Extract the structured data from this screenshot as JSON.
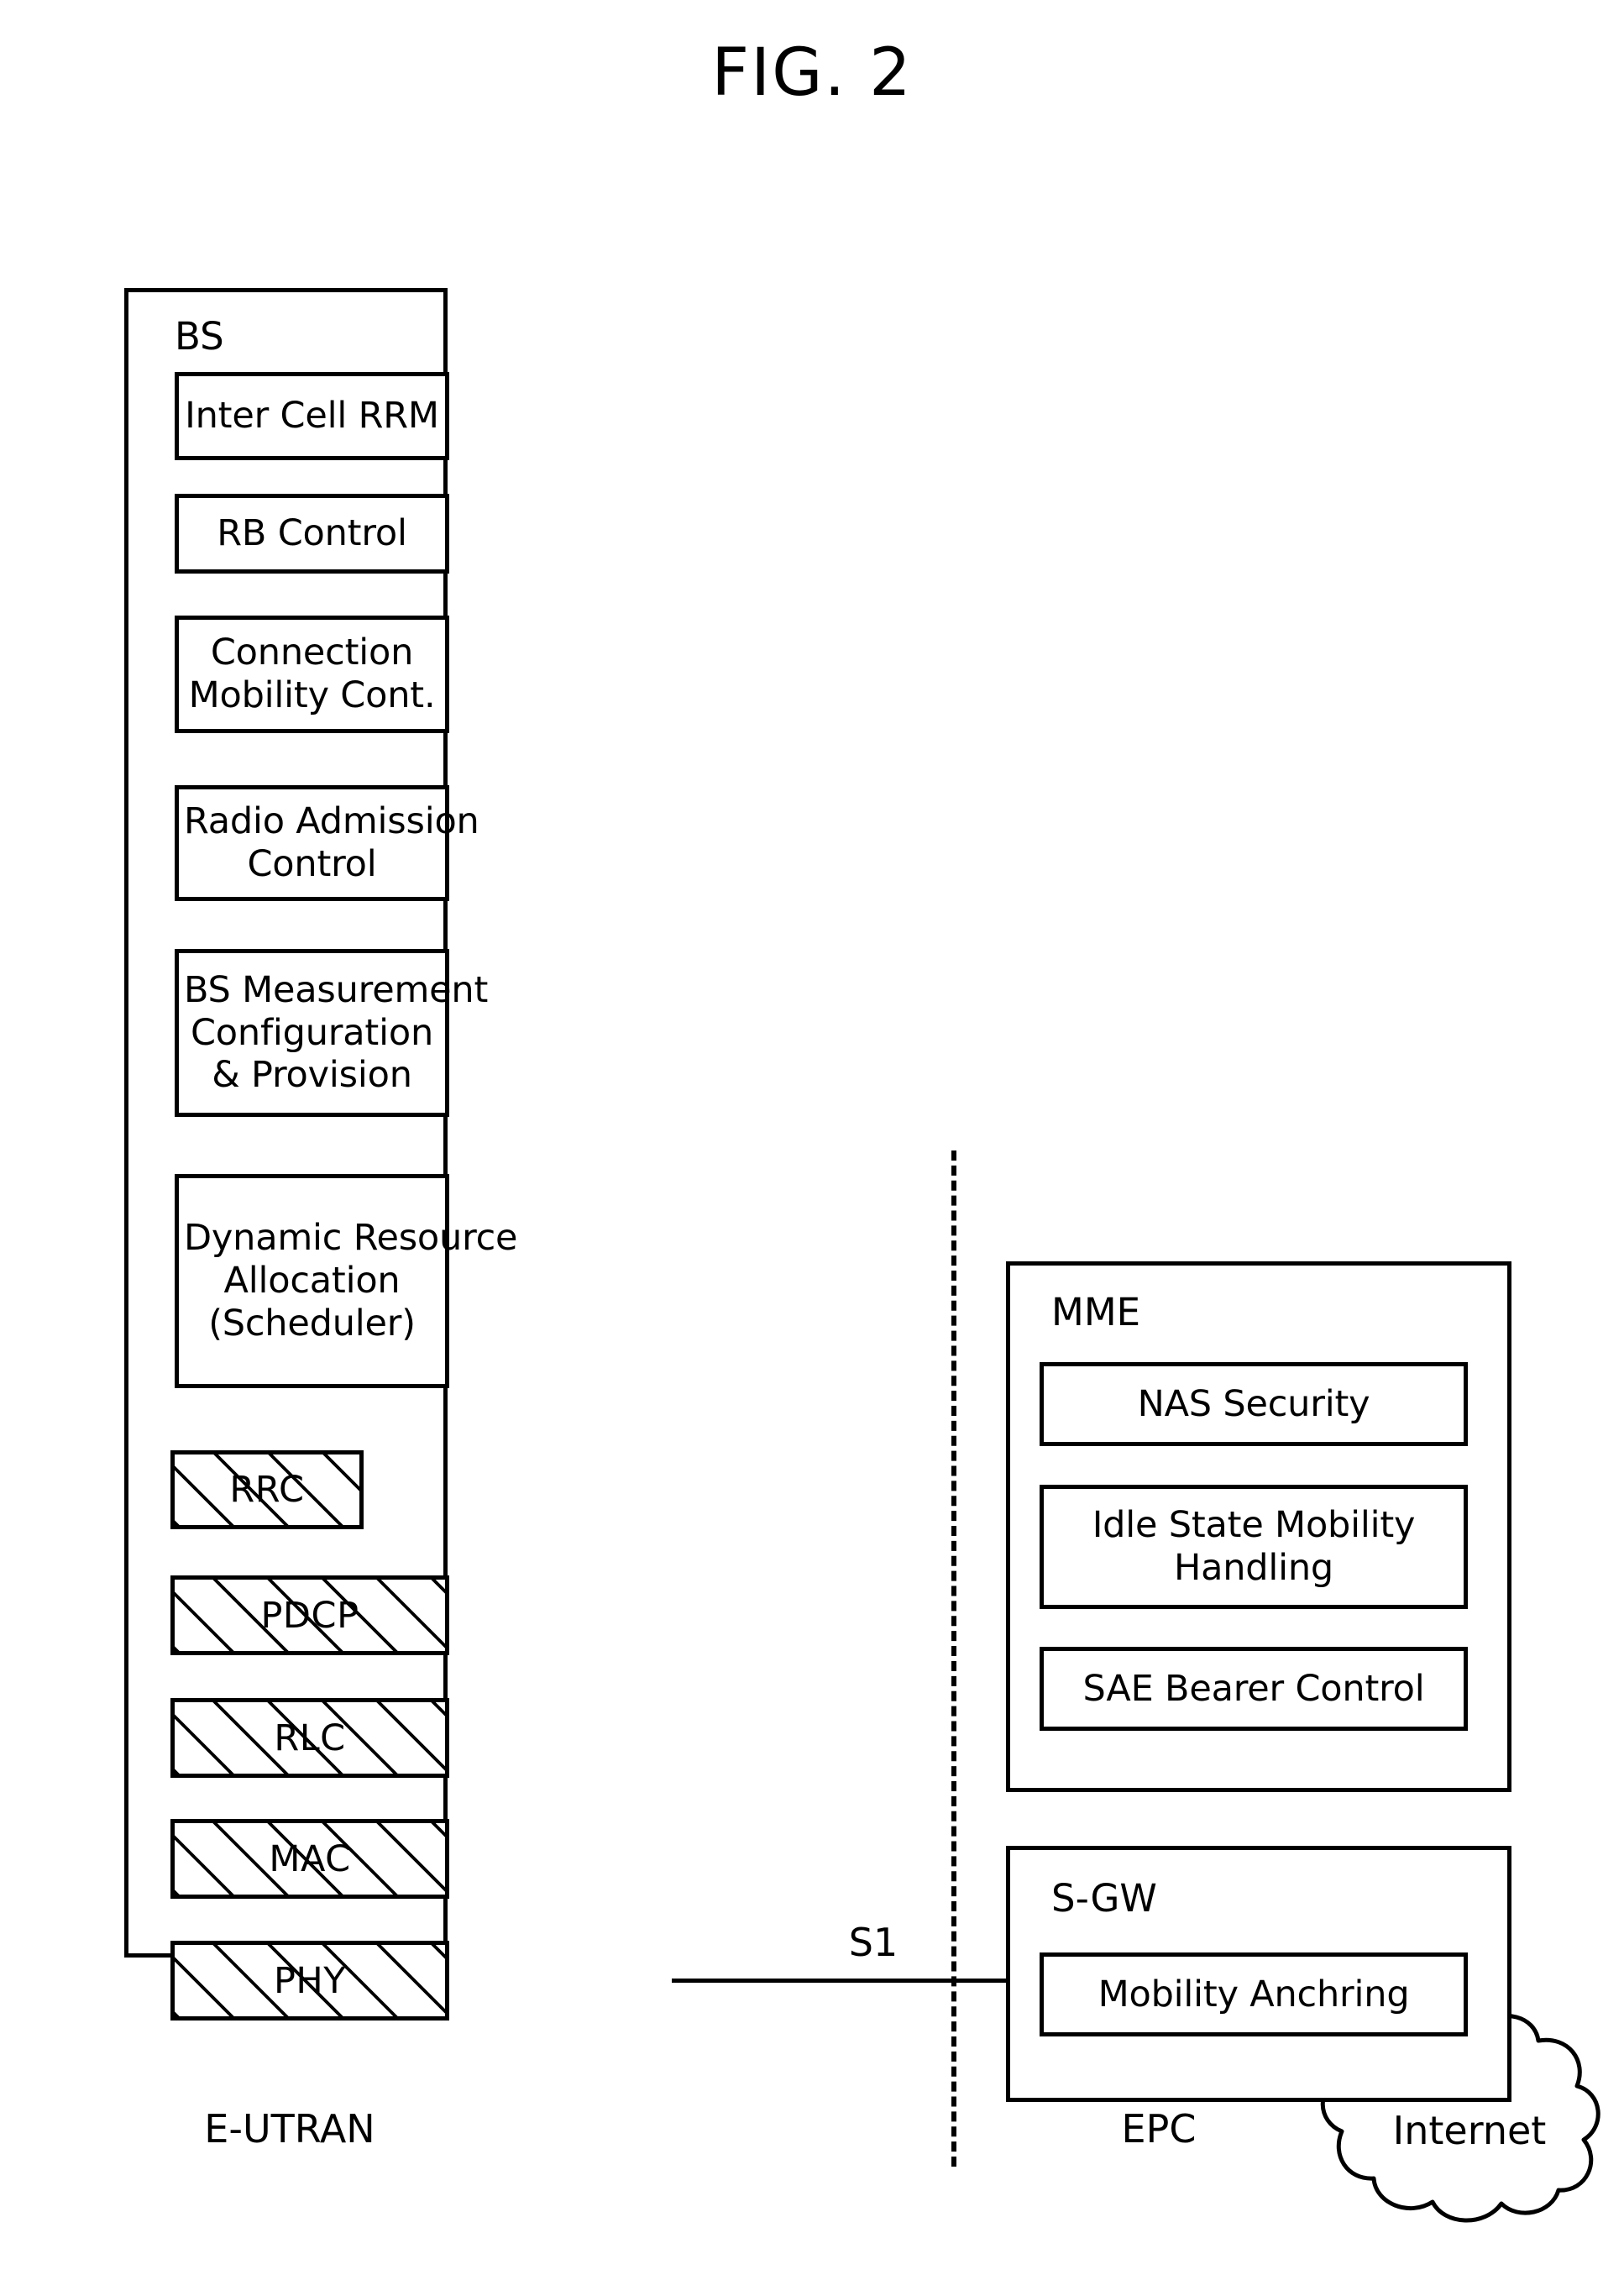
{
  "figure": {
    "title": "FIG. 2"
  },
  "eutran": {
    "node_label": "BS",
    "region_caption": "E-UTRAN",
    "functions": [
      {
        "lines": [
          "Inter Cell RRM"
        ]
      },
      {
        "lines": [
          "RB Control"
        ]
      },
      {
        "lines": [
          "Connection",
          "Mobility Cont."
        ]
      },
      {
        "lines": [
          "Radio Admission",
          "Control"
        ]
      },
      {
        "lines": [
          "BS Measurement",
          "Configuration",
          "& Provision"
        ]
      },
      {
        "lines": [
          "Dynamic Resource",
          "Allocation",
          "(Scheduler)"
        ]
      }
    ],
    "protocol_layers": [
      {
        "label": "RRC"
      },
      {
        "label": "PDCP"
      },
      {
        "label": "RLC"
      },
      {
        "label": "MAC"
      },
      {
        "label": "PHY"
      }
    ]
  },
  "interface": {
    "s1_label": "S1"
  },
  "epc": {
    "region_caption": "EPC",
    "mme": {
      "node_label": "MME",
      "functions": [
        {
          "lines": [
            "NAS Security"
          ]
        },
        {
          "lines": [
            "Idle State Mobility",
            "Handling"
          ]
        },
        {
          "lines": [
            "SAE Bearer Control"
          ]
        }
      ]
    },
    "sgw": {
      "node_label": "S-GW",
      "functions": [
        {
          "lines": [
            "Mobility Anchring"
          ]
        }
      ]
    }
  },
  "external": {
    "cloud_label": "Internet"
  },
  "style": {
    "stroke": "#000000",
    "background": "#ffffff"
  }
}
